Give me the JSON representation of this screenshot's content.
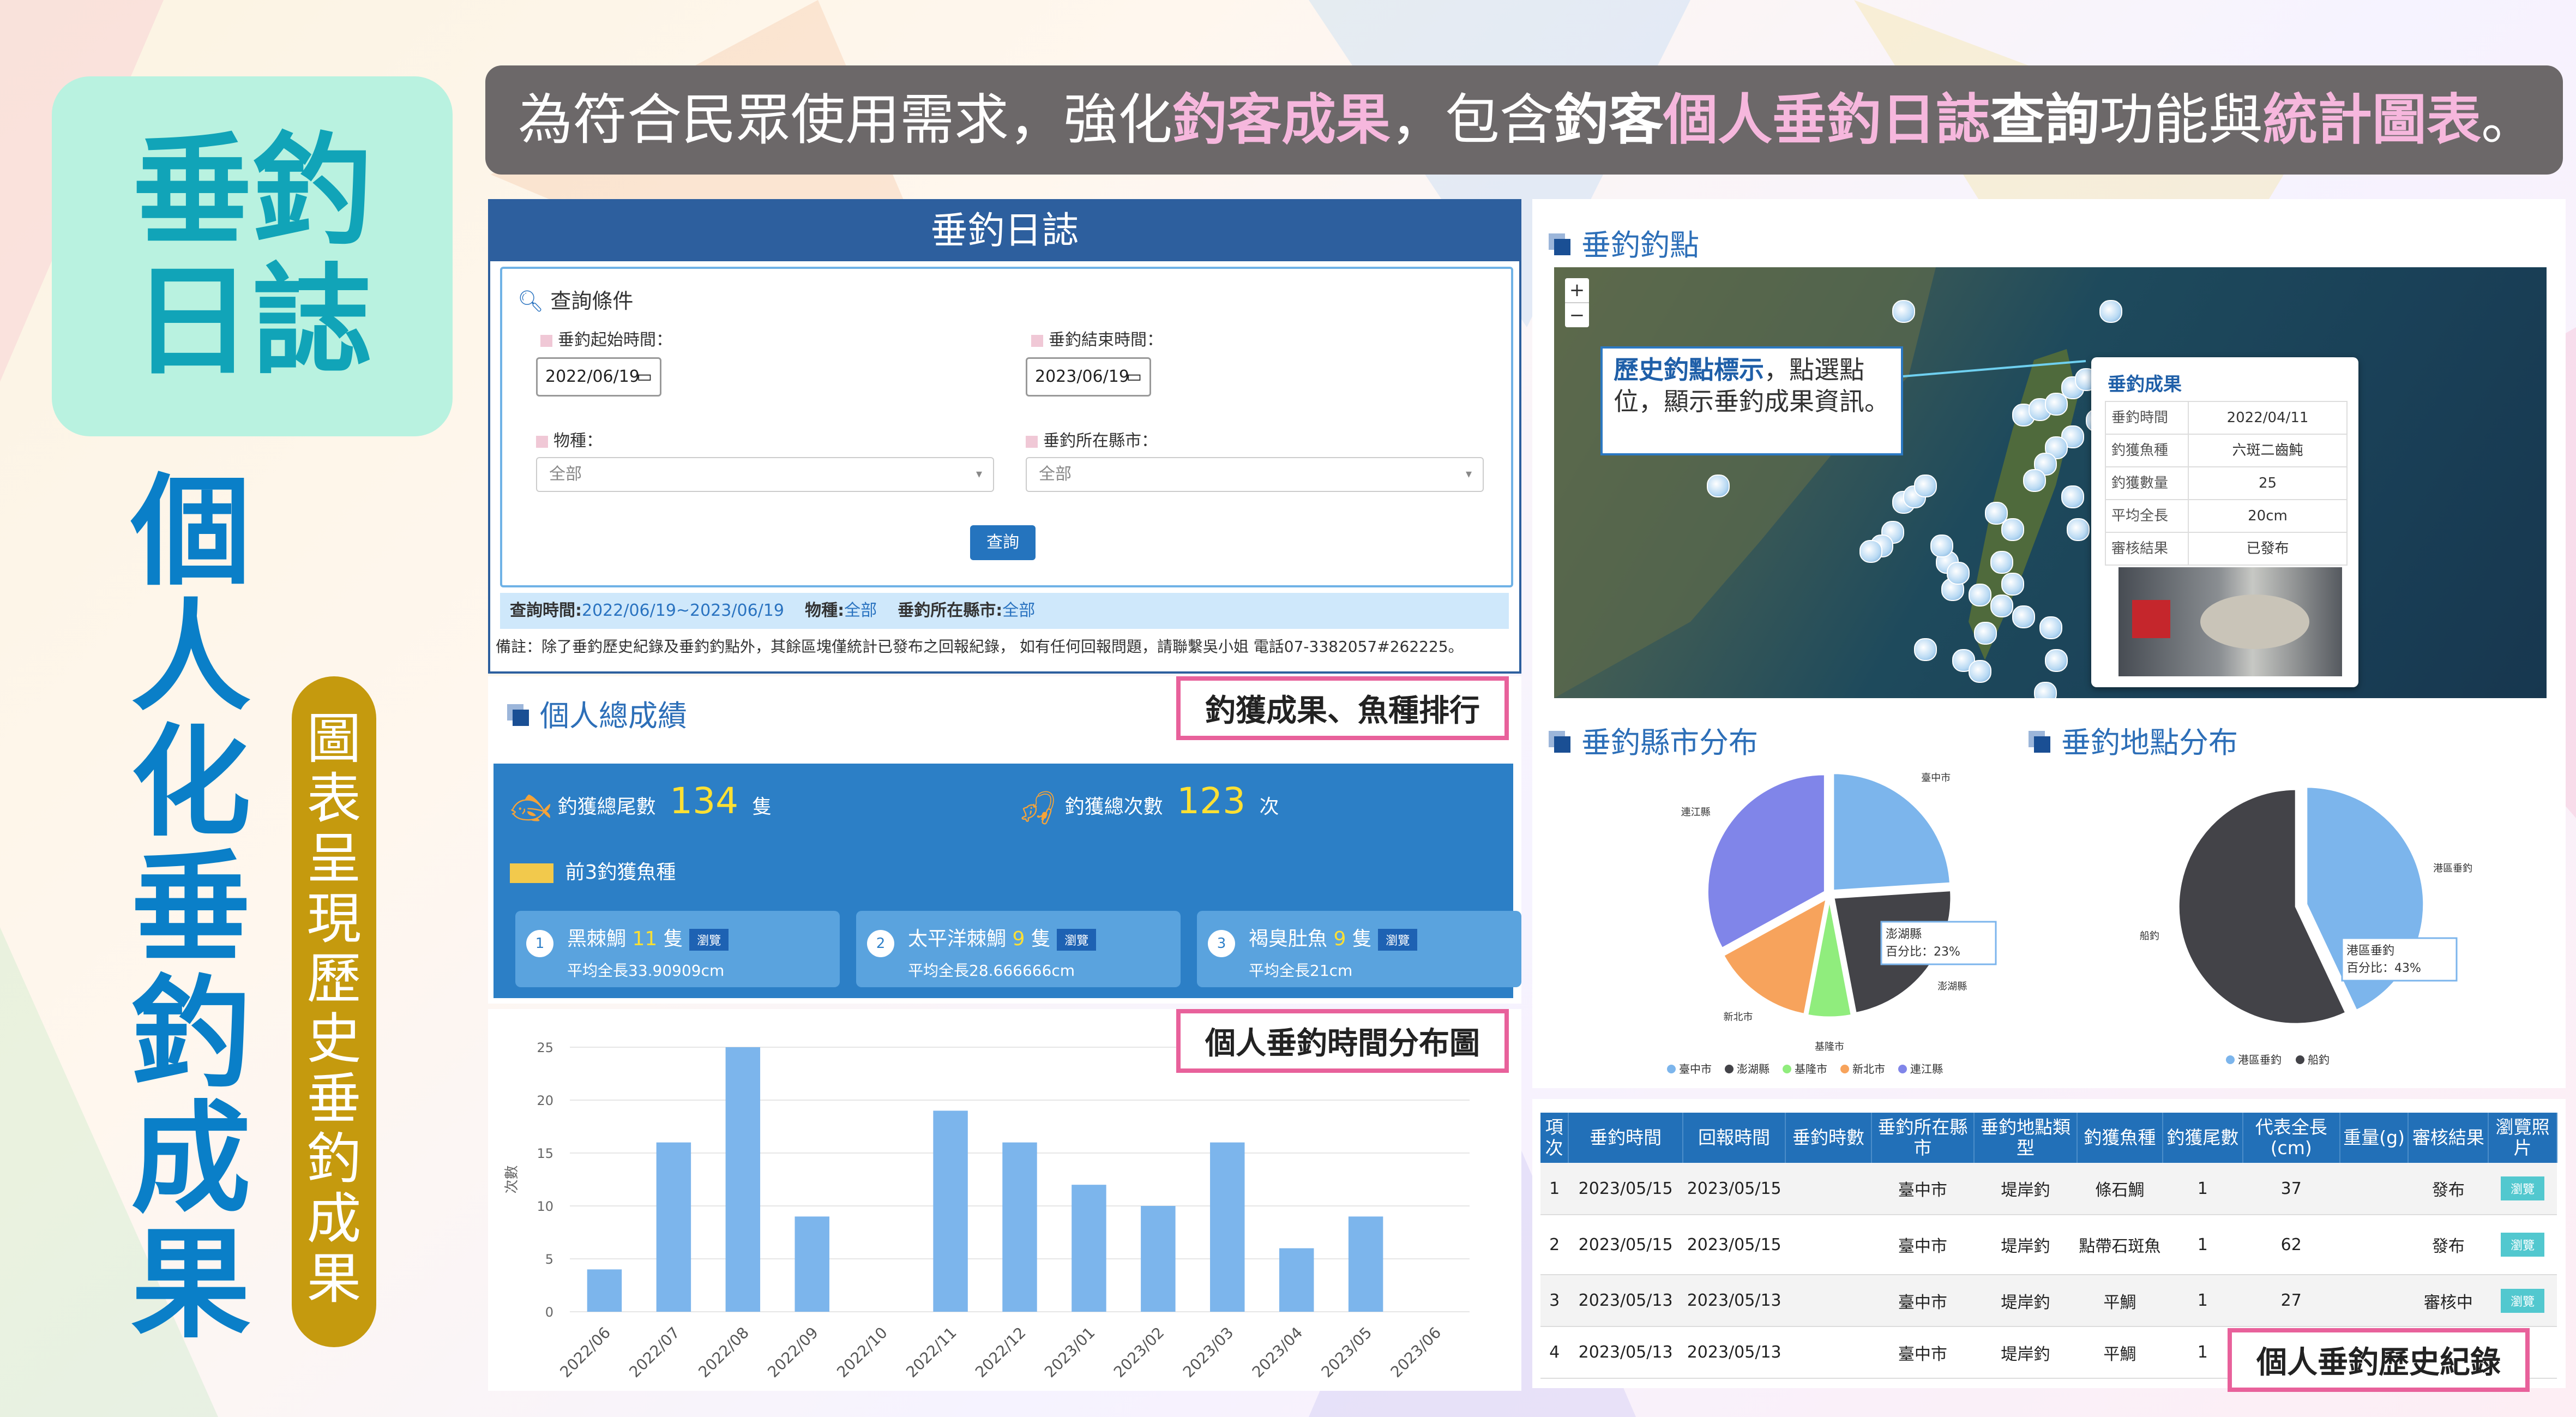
{
  "banner": {
    "parts": [
      {
        "t": "為符合民眾使用需求，強化",
        "c": "n"
      },
      {
        "t": "釣客成果",
        "c": "hl"
      },
      {
        "t": "，包含",
        "c": "n"
      },
      {
        "t": "釣客",
        "c": "bw"
      },
      {
        "t": "個人垂釣日誌",
        "c": "hl"
      },
      {
        "t": "查詢",
        "c": "bw"
      },
      {
        "t": "功能與",
        "c": "n"
      },
      {
        "t": "統計圖表",
        "c": "hl"
      },
      {
        "t": "。",
        "c": "n"
      }
    ]
  },
  "left": {
    "title_line1": "垂釣",
    "title_line2": "日誌",
    "subtitle": [
      "個",
      "人",
      "化",
      "垂",
      "釣",
      "成",
      "果"
    ],
    "pill": [
      "圖",
      "表",
      "呈",
      "現",
      "歷",
      "史",
      "垂",
      "釣",
      "成",
      "果"
    ]
  },
  "log": {
    "header": "垂釣日誌",
    "query_title": "查詢條件",
    "start_label": "垂釣起始時間：",
    "start_value": "2022/06/19",
    "end_label": "垂釣結束時間：",
    "end_value": "2023/06/19",
    "species_label": "物種：",
    "species_value": "全部",
    "city_label": "垂釣所在縣市：",
    "city_value": "全部",
    "query_button": "查詢",
    "summary_time_label": "查詢時間:",
    "summary_time": "2022/06/19~2023/06/19",
    "summary_species_label": "物種:",
    "summary_species": "全部",
    "summary_city_label": "垂釣所在縣市:",
    "summary_city": "全部",
    "note": "備註：除了垂釣歷史紀錄及垂釣釣點外，其餘區塊僅統計已發布之回報紀錄， 如有任何回報問題，請聯繫吳小姐 電話07-3382057#262225。"
  },
  "personal": {
    "title": "個人總成績",
    "tag": "釣獲成果、魚種排行",
    "total_fish_label": "釣獲總尾數",
    "total_fish": "134",
    "total_fish_unit": "隻",
    "total_times_label": "釣獲總次數",
    "total_times": "123",
    "total_times_unit": "次",
    "top3_label": "前3釣獲魚種",
    "top3": [
      {
        "rank": "1",
        "name": "黑棘鯛",
        "count": "11",
        "unit": "隻",
        "btn": "瀏覽",
        "avg": "平均全長33.90909cm"
      },
      {
        "rank": "2",
        "name": "太平洋棘鯛",
        "count": "9",
        "unit": "隻",
        "btn": "瀏覽",
        "avg": "平均全長28.666666cm"
      },
      {
        "rank": "3",
        "name": "褐臭肚魚",
        "count": "9",
        "unit": "隻",
        "btn": "瀏覽",
        "avg": "平均全長21cm"
      }
    ]
  },
  "time_chart": {
    "tag": "個人垂釣時間分布圖",
    "chart_data": {
      "type": "bar",
      "categories": [
        "2022/06",
        "2022/07",
        "2022/08",
        "2022/09",
        "2022/10",
        "2022/11",
        "2022/12",
        "2023/01",
        "2023/02",
        "2023/03",
        "2023/04",
        "2023/05",
        "2023/06"
      ],
      "values": [
        4,
        16,
        25,
        9,
        0,
        19,
        16,
        12,
        10,
        16,
        6,
        9,
        0
      ],
      "ylabel": "次數",
      "ylim": [
        0,
        25
      ],
      "yticks": [
        "0",
        "5",
        "10",
        "15",
        "20",
        "25"
      ],
      "color": "#7cb5ec"
    }
  },
  "map": {
    "title": "垂釣釣點",
    "zoom_in": "+",
    "zoom_out": "−",
    "callout_bold": "歷史釣點標示",
    "callout_rest": "，點選點位，顯示垂釣成果資訊。",
    "popup": {
      "title": "垂釣成果",
      "rows": [
        {
          "k": "垂釣時間",
          "v": "2022/04/11"
        },
        {
          "k": "釣獲魚種",
          "v": "六斑二齒魨"
        },
        {
          "k": "釣獲數量",
          "v": "25"
        },
        {
          "k": "平均全長",
          "v": "20cm"
        },
        {
          "k": "審核結果",
          "v": "已發布"
        }
      ]
    }
  },
  "city_pie": {
    "title": "垂釣縣市分布",
    "tooltip_name": "澎湖縣",
    "tooltip_pct": "百分比：23%",
    "chart_data": {
      "type": "pie",
      "slices": [
        {
          "name": "臺中市",
          "value": 24,
          "color": "#7cb5ec"
        },
        {
          "name": "澎湖縣",
          "value": 23,
          "color": "#434348"
        },
        {
          "name": "基隆市",
          "value": 6,
          "color": "#90ed7d"
        },
        {
          "name": "新北市",
          "value": 14,
          "color": "#f7a35c"
        },
        {
          "name": "連江縣",
          "value": 33,
          "color": "#8085e9"
        }
      ]
    }
  },
  "place_pie": {
    "title": "垂釣地點分布",
    "tooltip_name": "港區垂釣",
    "tooltip_pct": "百分比：43%",
    "chart_data": {
      "type": "pie",
      "slices": [
        {
          "name": "港區垂釣",
          "value": 43,
          "color": "#7cb5ec"
        },
        {
          "name": "船釣",
          "value": 57,
          "color": "#434348"
        }
      ]
    }
  },
  "history": {
    "tag": "個人垂釣歷史紀錄",
    "columns": [
      "項次",
      "垂釣時間",
      "回報時間",
      "垂釣時數",
      "垂釣所在縣市",
      "垂釣地點類型",
      "釣獲魚種",
      "釣獲尾數",
      "代表全長(cm)",
      "重量(g)",
      "審核結果",
      "瀏覽照片"
    ],
    "rows": [
      [
        "1",
        "2023/05/15",
        "2023/05/15",
        "",
        "臺中市",
        "堤岸釣",
        "條石鯛",
        "1",
        "37",
        "",
        "發布",
        "瀏覽"
      ],
      [
        "2",
        "2023/05/15",
        "2023/05/15",
        "",
        "臺中市",
        "堤岸釣",
        "點帶石斑魚",
        "1",
        "62",
        "",
        "發布",
        "瀏覽"
      ],
      [
        "3",
        "2023/05/13",
        "2023/05/13",
        "",
        "臺中市",
        "堤岸釣",
        "平鯛",
        "1",
        "27",
        "",
        "審核中",
        "瀏覽"
      ],
      [
        "4",
        "2023/05/13",
        "2023/05/13",
        "",
        "臺中市",
        "堤岸釣",
        "平鯛",
        "1",
        "",
        "",
        "",
        ""
      ]
    ]
  }
}
